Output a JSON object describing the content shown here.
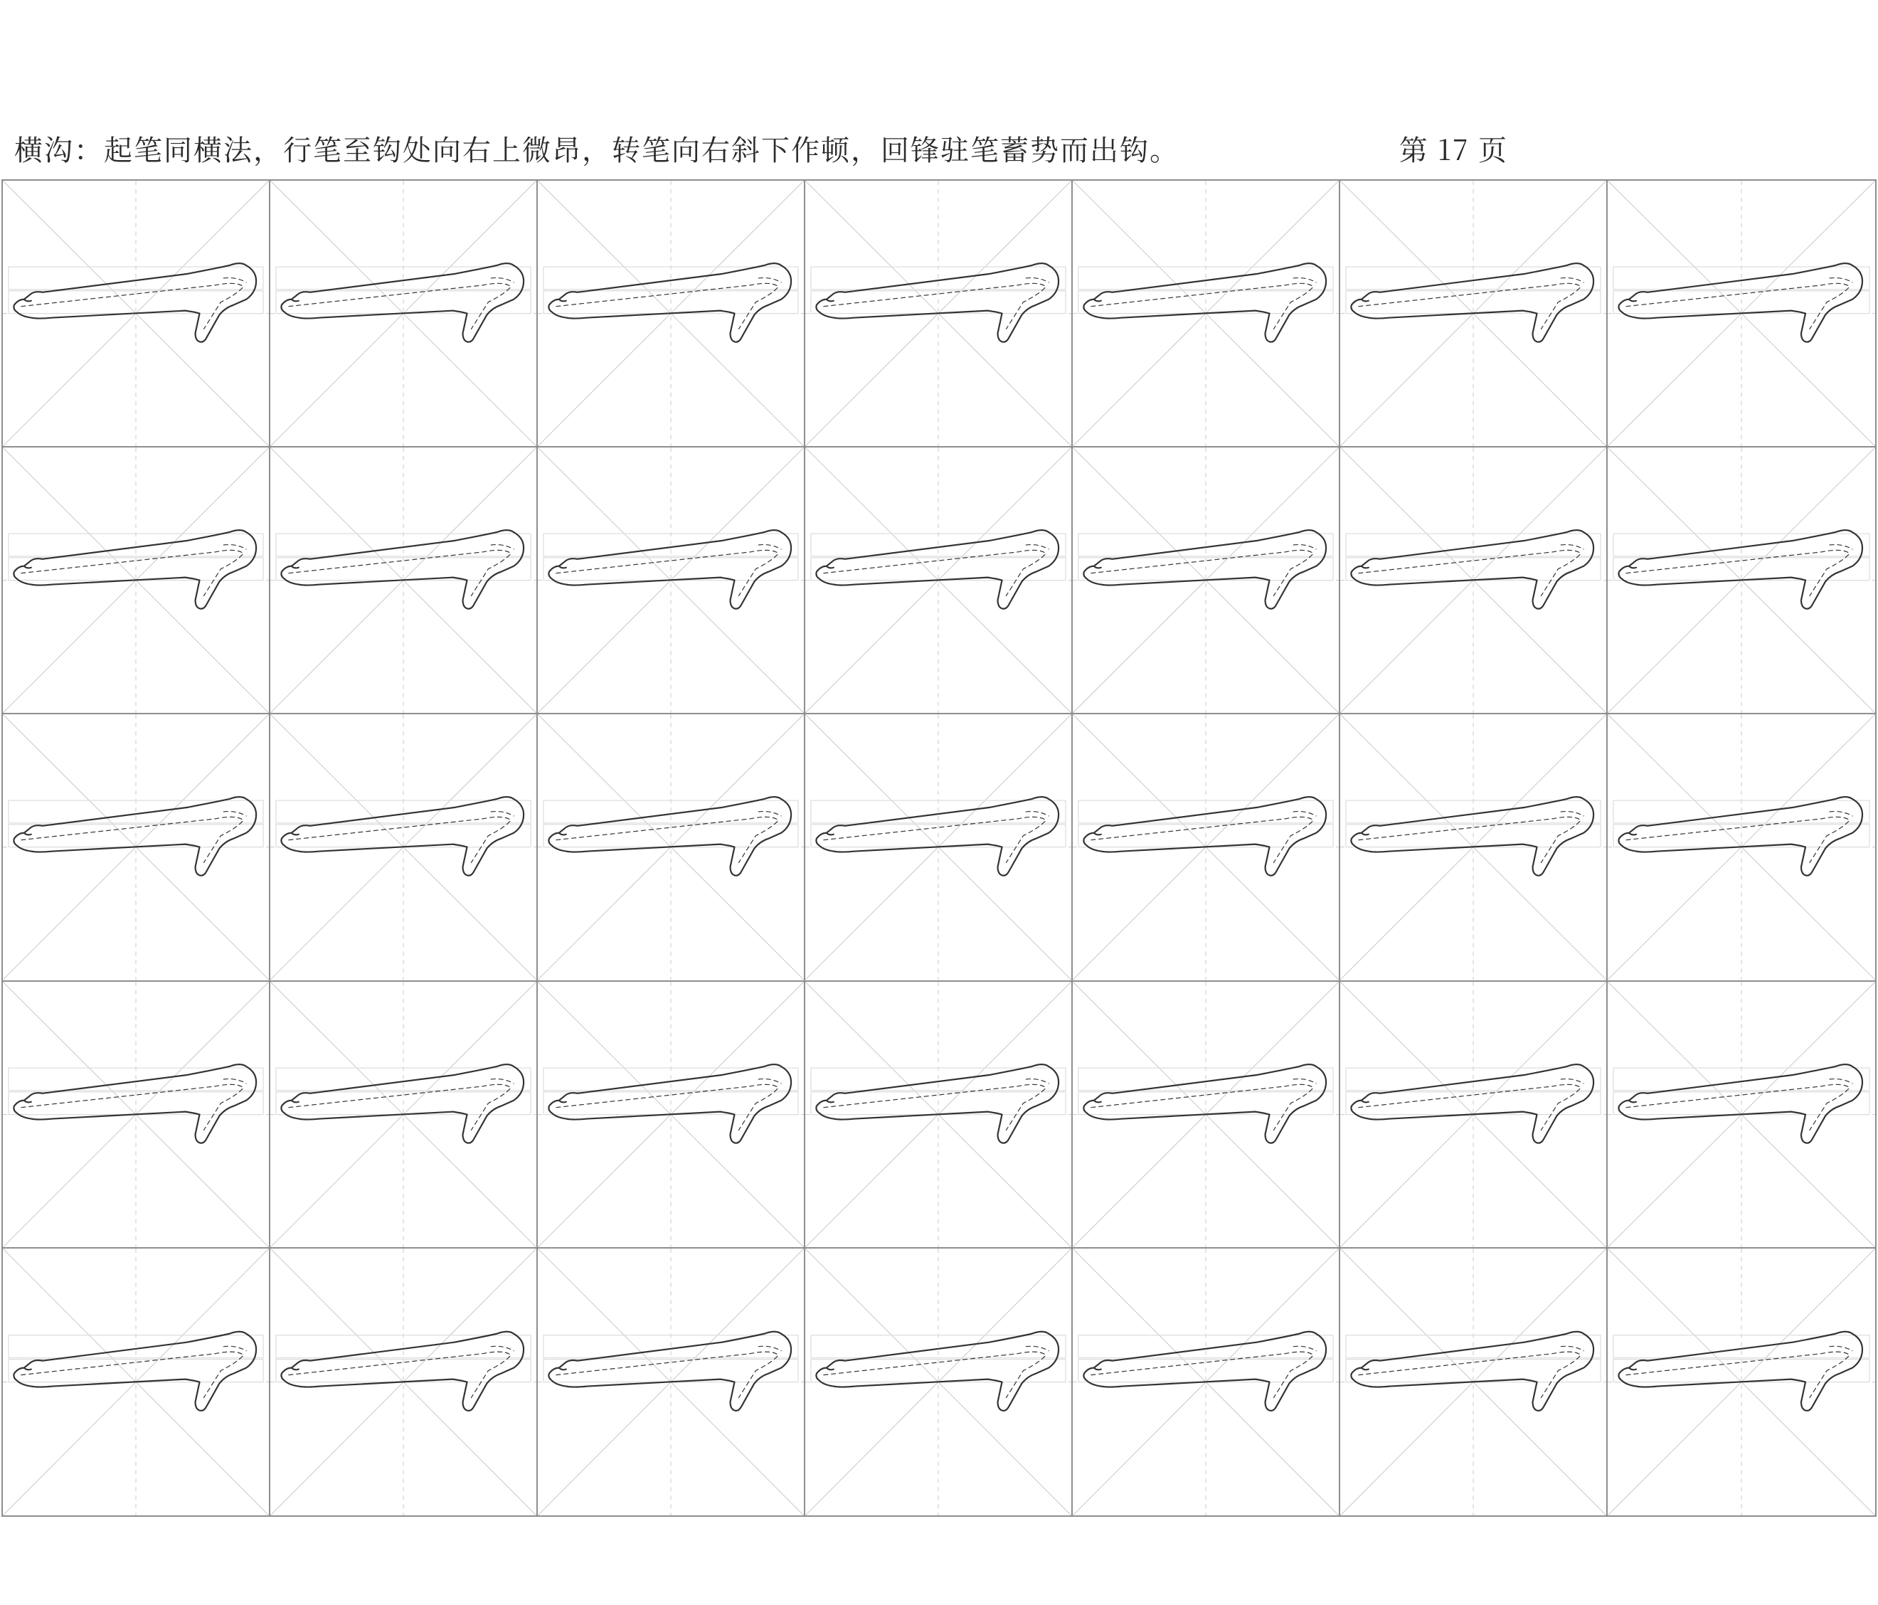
{
  "header": {
    "instruction": "横沟：起笔同横法，行笔至钩处向右上微昂，转笔向右斜下作顿，回锋驻笔蓄势而出钩。",
    "page_label": "第 17 页"
  },
  "grid": {
    "rows": 5,
    "cols": 7,
    "stroke_name": "横沟",
    "cells_all_same": true
  }
}
